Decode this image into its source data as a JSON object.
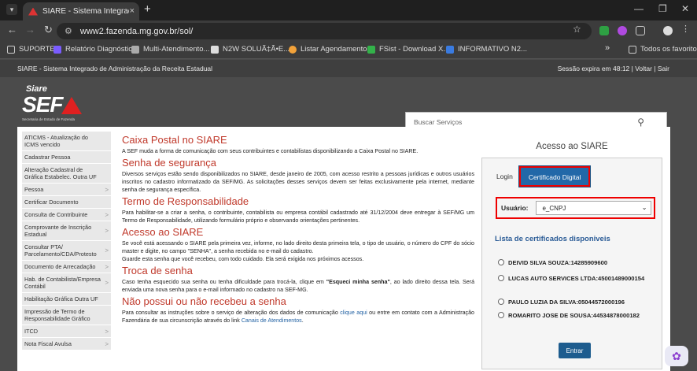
{
  "browser": {
    "tab_title": "SIARE - Sistema Integrado de A",
    "tab_close": "×",
    "new_tab": "+",
    "url": "www2.fazenda.mg.gov.br/sol/",
    "bookmarks": [
      {
        "label": "SUPORTE",
        "color": "#cccccc"
      },
      {
        "label": "Relatório Diagnóstic...",
        "color": "#7a5cff"
      },
      {
        "label": "Multi-Atendimento...",
        "color": "#aaaaaa"
      },
      {
        "label": "N2W SOLUÃ‡Ã•E...",
        "color": "#dddddd"
      },
      {
        "label": "Listar Agendamento...",
        "color": "#f2a23a"
      },
      {
        "label": "FSist - Download X...",
        "color": "#33b24a"
      },
      {
        "label": "INFORMATIVO N2...",
        "color": "#3a7be0"
      }
    ],
    "bookmarks_more": "»",
    "all_favorites": "Todos os favoritos"
  },
  "siare": {
    "topbar_left": "SIARE - Sistema Integrado de Administração da Receita Estadual",
    "topbar_right": "Sessão expira em 48:12 | Voltar | Sair",
    "logo_small": "Siare",
    "logo_big": "SEF",
    "logo_sub": "Secretaria de Estado de Fazenda",
    "search_placeholder": "Buscar Serviços"
  },
  "sidebar": [
    {
      "label": "ATICMS - Atualização do ICMS vencido",
      "arrow": ""
    },
    {
      "label": "Cadastrar Pessoa",
      "arrow": ""
    },
    {
      "label": "Alteração Cadastral de Gráfica Estabelec. Outra UF",
      "arrow": ""
    },
    {
      "label": "Pessoa",
      "arrow": ">"
    },
    {
      "label": "Certificar Documento",
      "arrow": ""
    },
    {
      "label": "Consulta de Contribuinte",
      "arrow": ">"
    },
    {
      "label": "Comprovante de Inscrição Estadual",
      "arrow": ">"
    },
    {
      "label": "Consultar PTA/ Parcelamento/CDA/Protesto",
      "arrow": ">"
    },
    {
      "label": "Documento de Arrecadação",
      "arrow": ">"
    },
    {
      "label": "Hab. de Contabilista/Empresa Contábil",
      "arrow": ">"
    },
    {
      "label": "Habilitação Gráfica Outra UF",
      "arrow": ""
    },
    {
      "label": "Impressão de Termo de Responsabilidade Gráfico",
      "arrow": ""
    },
    {
      "label": "ITCD",
      "arrow": ">"
    },
    {
      "label": "Nota Fiscal Avulsa",
      "arrow": ">"
    }
  ],
  "main": {
    "s1_title": "Caixa Postal no SIARE",
    "s1_text": "A SEF muda a forma de comunicação com seus contribuintes e contabilistas disponibilizando a Caixa Postal no SIARE.",
    "s2_title": "Senha de segurança",
    "s2_text": "Diversos serviços estão sendo disponibilizados no SIARE, desde janeiro de 2005, com acesso restrito a pessoas jurídicas e outros usuários inscritos no cadastro informatizado da SEF/MG. As solicitações desses serviços devem ser feitas exclusivamente pela internet, mediante senha de segurança específica.",
    "s3_title": "Termo de Responsabilidade",
    "s3_text": "Para habilitar-se a criar a senha, o contribuinte, contabilista ou empresa contábil cadastrado até 31/12/2004 deve entregar à SEF/MG um Termo de Responsabilidade, utilizando formulário próprio e observando orientações pertinentes.",
    "s4_title": "Acesso ao SIARE",
    "s4_text": "Se você está acessando o SIARE pela primeira vez, informe, no lado direito desta primeira tela, o tipo de usuário, o número do CPF do sócio master e digite, no campo \"SENHA\", a senha recebida no e-mail do cadastro.",
    "s4_text2": "Guarde esta senha que você recebeu, com todo cuidado. Ela será exigida nos próximos acessos.",
    "s5_title": "Troca de senha",
    "s5_pre": "Caso tenha esquecido sua senha ou tenha dificuldade para trocá-la, clique em ",
    "s5_bold": "\"Esqueci minha senha\"",
    "s5_post": ", ao lado direito dessa tela. Será enviada uma nova senha para o e-mail informado no cadastro na SEF-MG.",
    "s6_title": "Não possui ou não recebeu a senha",
    "s6_pre": "Para consultar as instruções sobre o serviço de alteração dos dados de comunicação ",
    "s6_link1": "clique aqui",
    "s6_mid": " ou entre em contato com a Administração Fazendária de sua circunscrição através do link ",
    "s6_link2": "Canais de Atendimentos",
    "s6_end": "."
  },
  "access": {
    "title": "Acesso ao SIARE",
    "tab_login": "Login",
    "tab_cert": "Certificado Digital",
    "user_label": "Usuário:",
    "user_value": "e_CNPJ",
    "list_title": "Lista de certificados disponiveis",
    "certs": [
      "DEIVID SILVA SOUZA:14285909600",
      "LUCAS AUTO SERVICES LTDA:45001489000154",
      "PAULO LUZIA DA SILVA:05044572000196",
      "ROMARITO JOSE DE SOUSA:44534878000182"
    ],
    "enter": "Entrar"
  }
}
